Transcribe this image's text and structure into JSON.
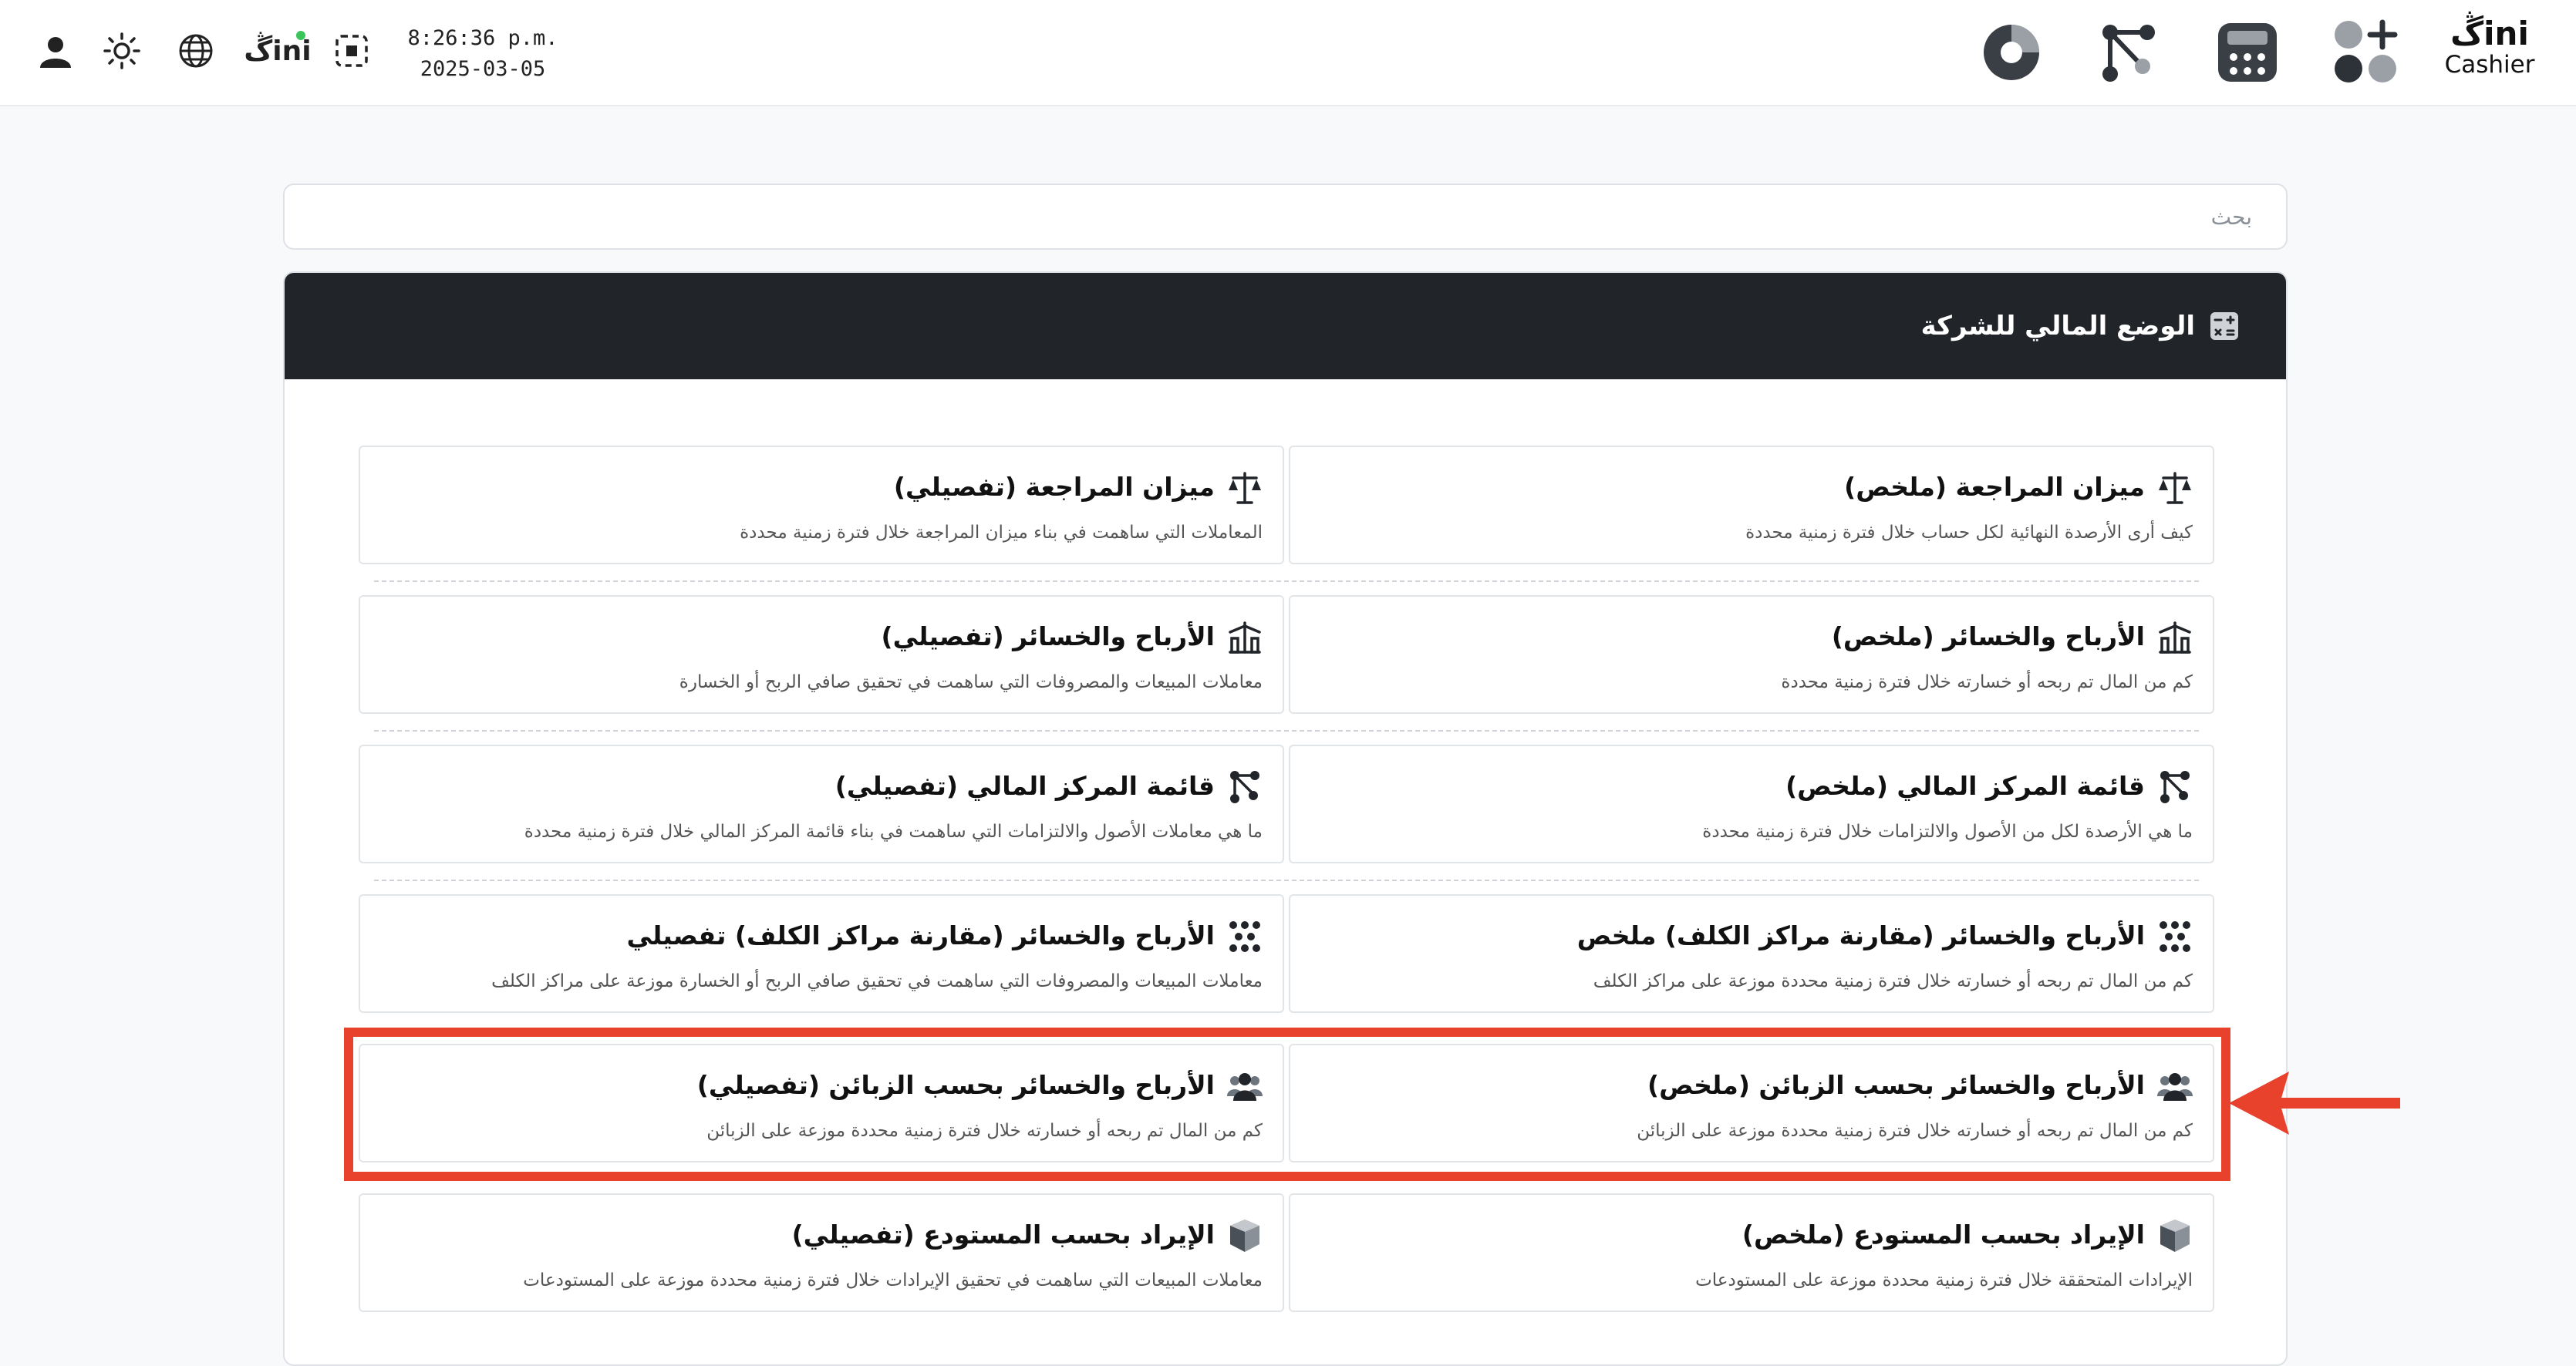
{
  "topbar": {
    "time": "8:26:36 p.m.",
    "date": "2025-03-05",
    "left_icons": [
      "user-icon",
      "sun-icon",
      "globe-icon",
      "gini-logo-icon",
      "screenshot-icon"
    ],
    "gini_logo_text": "ڴini",
    "apps": [
      "pie-chart-icon",
      "flow-nodes-icon",
      "calculator-icon",
      "add-apps-icon"
    ],
    "brand": {
      "mark": "ڴini",
      "word": "Cashier"
    }
  },
  "search": {
    "placeholder": "بحث"
  },
  "section": {
    "title": "الوضع المالي للشركة",
    "icon": "calculator-icon"
  },
  "reports": [
    {
      "title": "ميزان المراجعة (ملخص)",
      "description": "كيف أرى الأرصدة النهائية لكل حساب خلال فترة زمنية محددة",
      "icon": "scale-icon"
    },
    {
      "title": "ميزان المراجعة (تفصيلي)",
      "description": "المعاملات التي ساهمت في بناء ميزان المراجعة خلال فترة زمنية محددة",
      "icon": "scale-icon"
    },
    {
      "title": "الأرباح والخسائر (ملخص)",
      "description": "كم من المال تم ربحه أو خسارته خلال فترة زمنية محددة",
      "icon": "balance-chart-icon"
    },
    {
      "title": "الأرباح والخسائر (تفصيلي)",
      "description": "معاملات المبيعات والمصروفات التي ساهمت في تحقيق صافي الربح أو الخسارة",
      "icon": "balance-chart-icon"
    },
    {
      "title": "قائمة المركز المالي (ملخص)",
      "description": "ما هي الأرصدة لكل من الأصول والالتزامات خلال فترة زمنية محددة",
      "icon": "nodes-icon"
    },
    {
      "title": "قائمة المركز المالي (تفصيلي)",
      "description": "ما هي معاملات الأصول والالتزامات التي ساهمت في بناء قائمة المركز المالي خلال فترة زمنية محددة",
      "icon": "nodes-icon"
    },
    {
      "title": "الأرباح والخسائر (مقارنة مراكز الكلف) ملخص",
      "description": "كم من المال تم ربحه أو خسارته خلال فترة زمنية محددة موزعة على مراكز الكلف",
      "icon": "dots-grid-icon"
    },
    {
      "title": "الأرباح والخسائر (مقارنة مراكز الكلف) تفصيلي",
      "description": "معاملات المبيعات والمصروفات التي ساهمت في تحقيق صافي الربح أو الخسارة موزعة على مراكز الكلف",
      "icon": "dots-grid-icon"
    },
    {
      "title": "الأرباح والخسائر بحسب الزبائن (ملخص)",
      "description": "كم من المال تم ربحه أو خسارته خلال فترة زمنية محددة موزعة على الزبائن",
      "icon": "customers-icon"
    },
    {
      "title": "الأرباح والخسائر بحسب الزبائن (تفصيلي)",
      "description": "كم من المال تم ربحه أو خسارته خلال فترة زمنية محددة موزعة على الزبائن",
      "icon": "customers-icon"
    },
    {
      "title": "الإيراد بحسب المستودع (ملخص)",
      "description": "الإيرادات المتحققة خلال فترة زمنية محددة موزعة على المستودعات",
      "icon": "warehouse-icon"
    },
    {
      "title": "الإيراد بحسب المستودع (تفصيلي)",
      "description": "معاملات المبيعات التي ساهمت في تحقيق الإيرادات خلال فترة زمنية محددة موزعة على المستودعات",
      "icon": "warehouse-icon"
    }
  ],
  "colors": {
    "header_bg": "#212529",
    "highlight": "#e8412c",
    "accent_green": "#3cc45c"
  }
}
